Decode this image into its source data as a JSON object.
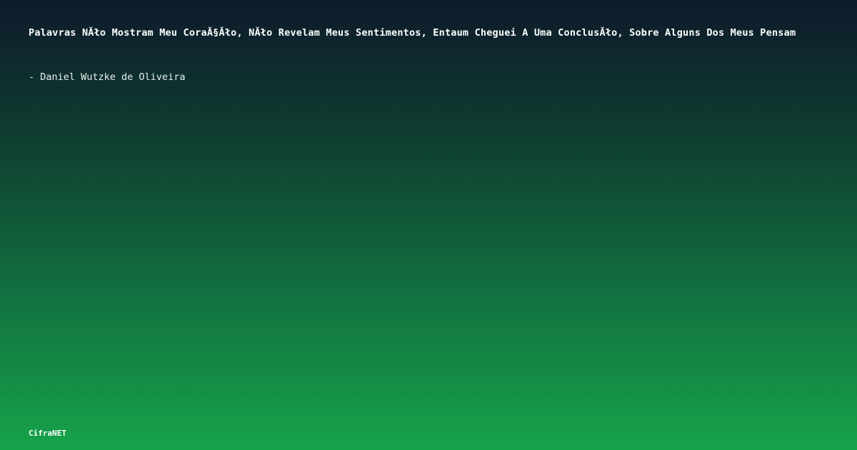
{
  "quote": {
    "text": "Palavras NĂło Mostram Meu CoraĂ§Ăło, NĂło Revelam Meus Sentimentos, Entaum Cheguei A Uma ConclusĂło, Sobre Alguns Dos Meus Pensam"
  },
  "author": {
    "text": "- Daniel Wutzke de Oliveira"
  },
  "brand": {
    "text": "CifraNET"
  }
}
